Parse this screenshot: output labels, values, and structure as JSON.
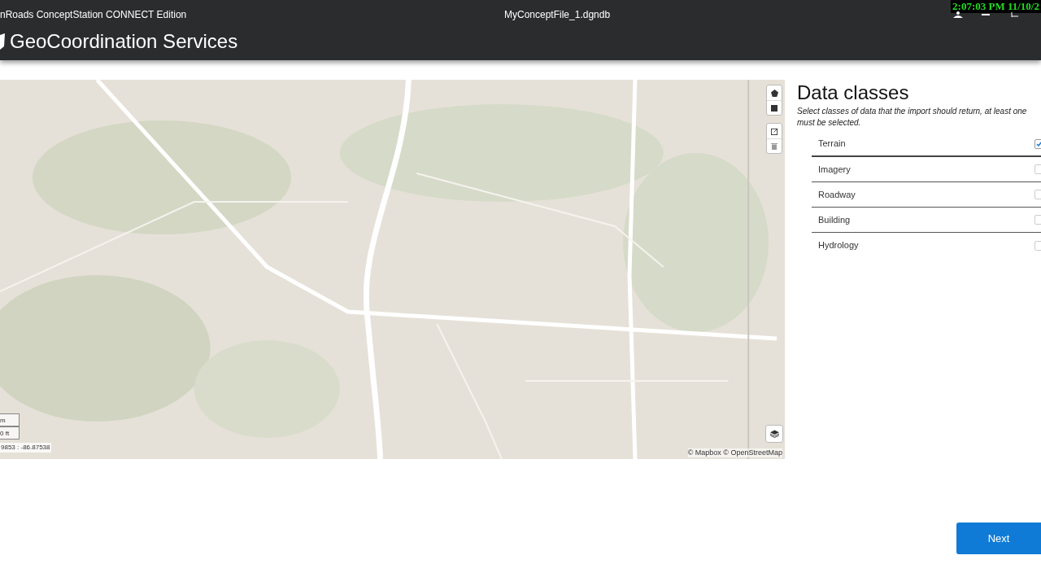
{
  "window": {
    "title_left": "nRoads ConceptStation CONNECT Edition",
    "title_center": "MyConceptFile_1.dgndb",
    "clock": "2:07:03 PM 11/10/2"
  },
  "header": {
    "title": "GeoCoordination Services"
  },
  "map": {
    "scale": [
      "m",
      "0 ft"
    ],
    "coordinates": "9853 : -86.87538",
    "attribution": "© Mapbox © OpenStreetMap"
  },
  "panel": {
    "title": "Data classes",
    "description": "Select classes of data that the import should return, at least one must be selected.",
    "items": [
      {
        "label": "Terrain",
        "checked": true
      },
      {
        "label": "Imagery",
        "checked": false
      },
      {
        "label": "Roadway",
        "checked": false
      },
      {
        "label": "Building",
        "checked": false
      },
      {
        "label": "Hydrology",
        "checked": false
      }
    ]
  },
  "buttons": {
    "next": "Next"
  }
}
